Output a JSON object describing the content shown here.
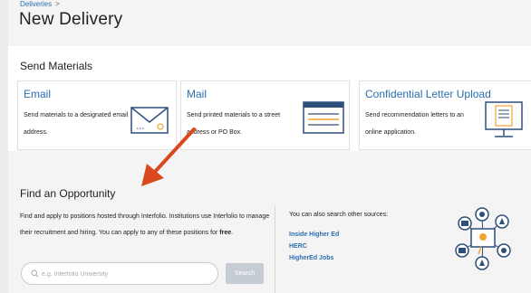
{
  "breadcrumb": {
    "link": "Deliveries",
    "separator": ">"
  },
  "page_title": "New Delivery",
  "send_materials": {
    "title": "Send Materials",
    "cards": [
      {
        "title": "Email",
        "description": "Send materials to a designated email address.",
        "icon": "envelope-icon"
      },
      {
        "title": "Mail",
        "description": "Send printed materials to a street address or PO Box.",
        "icon": "mail-package-icon"
      },
      {
        "title": "Confidential Letter Upload",
        "description": "Send recommendation letters to an online application.",
        "icon": "monitor-letter-icon"
      }
    ]
  },
  "find_opportunity": {
    "title": "Find an Opportunity",
    "description_main": "Find and apply to positions hosted through Interfolio. Institutions use Interfolio to manage their recruitment and hiring. You can apply to any of these positions for",
    "description_bold": "free",
    "description_end": ".",
    "search": {
      "placeholder": "e.g. Interfolio University",
      "button_label": "Search"
    },
    "sources_label": "You can also search other sources:",
    "sources": [
      "Inside Higher Ed",
      "HERC",
      "HigherEd Jobs"
    ]
  },
  "colors": {
    "link": "#2a6fb2",
    "accent_orange": "#f0a32e",
    "annotation_arrow": "#d9481f",
    "icon_navy": "#2d4f7a"
  }
}
